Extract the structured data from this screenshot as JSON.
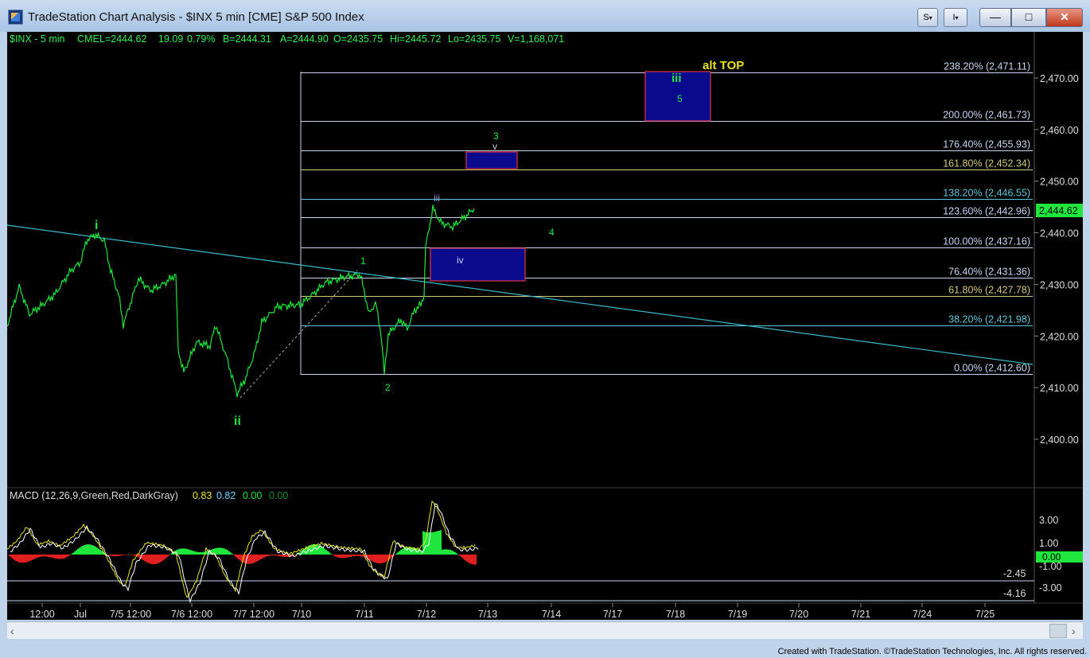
{
  "window": {
    "title": "TradeStation Chart Analysis - $INX 5 min [CME] S&P 500 Index",
    "btn_s": "S",
    "btn_i": "I",
    "dropdown": "▾",
    "minimize": "—",
    "maximize": "□",
    "close": "✕"
  },
  "header": {
    "symbol": "$INX - 5 min",
    "exchange": "CME",
    "last": "L=2444.62",
    "change": "19.09",
    "pct": "0.79%",
    "bid": "B=2444.31",
    "ask": "A=2444.90",
    "open": "O=2435.75",
    "high": "Hi=2445.72",
    "low": "Lo=2435.75",
    "volume": "V=1,168,071"
  },
  "price_axis": {
    "labels": [
      "2,470.00",
      "2,460.00",
      "2,450.00",
      "2,440.00",
      "2,430.00",
      "2,420.00",
      "2,410.00",
      "2,400.00"
    ],
    "last_price": "2,444.62"
  },
  "fibs": [
    {
      "label": "238.20% (2,471.11)",
      "color": "#c9d4f0"
    },
    {
      "label": "200.00% (2,461.73)",
      "color": "#c9d4f0"
    },
    {
      "label": "176.40% (2,455.93)",
      "color": "#c9d4f0"
    },
    {
      "label": "161.80% (2,452.34)",
      "color": "#d2c87a"
    },
    {
      "label": "138.20% (2,446.55)",
      "color": "#5fc4d6"
    },
    {
      "label": "123.60% (2,442.96)",
      "color": "#c9d4f0"
    },
    {
      "label": "100.00% (2,437.16)",
      "color": "#c9d4f0"
    },
    {
      "label": "76.40% (2,431.36)",
      "color": "#c9d4f0"
    },
    {
      "label": "61.80% (2,427.78)",
      "color": "#d2c87a"
    },
    {
      "label": "38.20% (2,421.98)",
      "color": "#5fc4d6"
    },
    {
      "label": "0.00% (2,412.60)",
      "color": "#c9d4f0"
    }
  ],
  "annotations": {
    "alt_top": "alt TOP",
    "iii_big": "iii",
    "five": "5",
    "three": "3",
    "v": "v",
    "iii_small": "iii",
    "four": "4",
    "iv": "iv",
    "one": "1",
    "two": "2",
    "i": "i",
    "ii": "ii"
  },
  "macd": {
    "label": "MACD (12,26,9,Green,Red,DarkGray)",
    "v1": "0.83",
    "v2": "0.82",
    "v3": "0.00",
    "v4": "0.00",
    "axis": [
      "3.00",
      "1.00",
      "0.00",
      "-1.00",
      "-2.45",
      "-3.00",
      "-4.16"
    ]
  },
  "time_axis": [
    "12:00",
    "Jul",
    "7/5 12:00",
    "7/6 12:00",
    "7/7 12:00",
    "7/10",
    "7/11",
    "7/12",
    "7/13",
    "7/14",
    "7/17",
    "7/18",
    "7/19",
    "7/20",
    "7/21",
    "7/24",
    "7/25"
  ],
  "footer": "Created with TradeStation. ©TradeStation Technologies, Inc. All rights reserved.",
  "colors": {
    "accent_green": "#1ee63c",
    "trendline": "#38b9c9",
    "box_fill": "#0a0a8c",
    "box_border": "#e0344a",
    "label_yellow": "#e7e21d"
  }
}
